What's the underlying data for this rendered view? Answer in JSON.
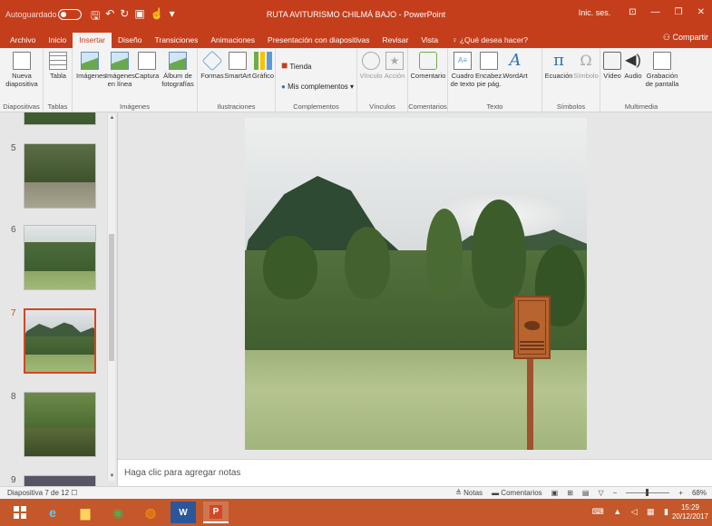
{
  "titlebar": {
    "autosave_label": "Autoguardado",
    "document_title": "RUTA AVITURISMO CHILMÁ BAJO - PowerPoint",
    "signin": "Inic. ses.",
    "color": "#c43e1c"
  },
  "tabs": [
    {
      "label": "Archivo"
    },
    {
      "label": "Inicio"
    },
    {
      "label": "Insertar",
      "active": true
    },
    {
      "label": "Diseño"
    },
    {
      "label": "Transiciones"
    },
    {
      "label": "Animaciones"
    },
    {
      "label": "Presentación con diapositivas"
    },
    {
      "label": "Revisar"
    },
    {
      "label": "Vista"
    }
  ],
  "tellme": "¿Qué desea hacer?",
  "share": "Compartir",
  "ribbon": {
    "diapositivas": {
      "label": "Diapositivas",
      "nueva_line1": "Nueva",
      "nueva_line2": "diapositiva"
    },
    "tablas": {
      "label": "Tablas",
      "tabla": "Tabla"
    },
    "imagenes": {
      "label": "Imágenes",
      "imagenes": "Imágenes",
      "en_linea_1": "Imágenes",
      "en_linea_2": "en línea",
      "captura": "Captura",
      "album_1": "Álbum de",
      "album_2": "fotografías"
    },
    "ilustraciones": {
      "label": "Ilustraciones",
      "formas": "Formas",
      "smartart": "SmartArt",
      "grafico": "Gráfico"
    },
    "complementos": {
      "label": "Complementos",
      "tienda": "Tienda",
      "mis": "Mis complementos"
    },
    "vinculos": {
      "label": "Vínculos",
      "vinculo": "Vínculo",
      "accion": "Acción"
    },
    "comentarios": {
      "label": "Comentarios",
      "comentario": "Comentario"
    },
    "texto": {
      "label": "Texto",
      "cuadro_1": "Cuadro",
      "cuadro_2": "de texto",
      "encab_1": "Encabez.",
      "encab_2": "pie pág.",
      "wordart": "WordArt"
    },
    "simbolos": {
      "label": "Símbolos",
      "ecuacion": "Ecuación",
      "simbolo": "Símbolo"
    },
    "multimedia": {
      "label": "Multimedia",
      "video": "Vídeo",
      "audio": "Audio",
      "grabacion_1": "Grabación",
      "grabacion_2": "de pantalla"
    }
  },
  "thumbnails": [
    {
      "number": "5"
    },
    {
      "number": "6"
    },
    {
      "number": "7",
      "active": true
    },
    {
      "number": "8"
    },
    {
      "number": "9"
    }
  ],
  "notes_placeholder": "Haga clic para agregar notas",
  "status": {
    "slide_info": "Diapositiva 7 de 12",
    "notes": "Notas",
    "comments": "Comentarios",
    "zoom": "68%"
  },
  "taskbar": {
    "time": "15:29",
    "date": "20/12/2017"
  }
}
